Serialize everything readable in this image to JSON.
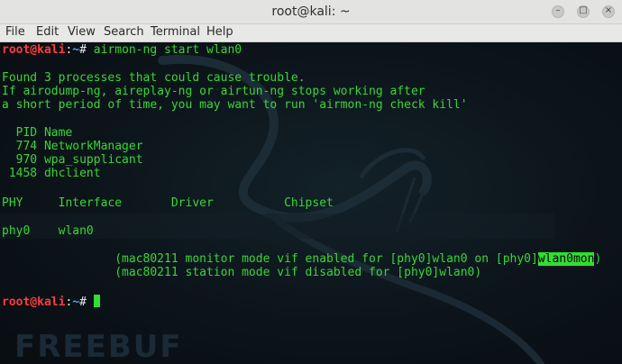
{
  "window": {
    "title": "root@kali: ~"
  },
  "menu": [
    "File",
    "Edit",
    "View",
    "Search",
    "Terminal",
    "Help"
  ],
  "prompt": {
    "user": "root@kali",
    "sep": ":",
    "path": "~",
    "sym": "#"
  },
  "command": " airmon-ng start wlan0",
  "output": {
    "warn1": "Found 3 processes that could cause trouble.",
    "warn2": "If airodump-ng, aireplay-ng or airtun-ng stops working after",
    "warn3": "a short period of time, you may want to run 'airmon-ng check kill'",
    "proc_header": "  PID Name",
    "procs": [
      "  774 NetworkManager",
      "  970 wpa_supplicant",
      " 1458 dhclient"
    ],
    "iface_header": "PHY     Interface       Driver          Chipset",
    "iface_row": "phy0    wlan0",
    "mon1_pre": "                (mac80211 monitor mode vif enabled for [phy0]wlan0 on [phy0]",
    "mon1_hl": "wlan0mon",
    "mon1_post": ")",
    "mon2": "                (mac80211 station mode vif disabled for [phy0]wlan0)"
  },
  "watermark": "FREEBUF"
}
